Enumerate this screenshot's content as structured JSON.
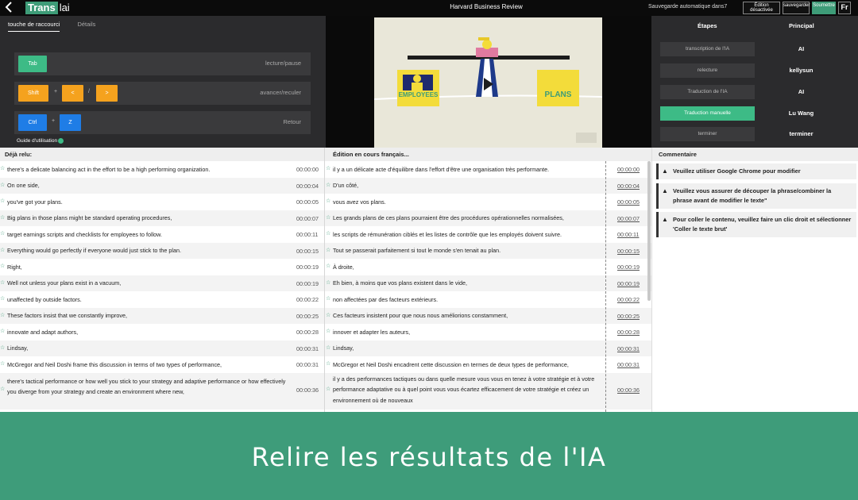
{
  "header": {
    "logo_part1": "Trans",
    "logo_part2": "lai",
    "doc_title": "Harvard Business Review",
    "autosave": "Sauvegarde automatique dans7",
    "edit_disabled": "Édition désactivée",
    "save": "sauvegarder",
    "submit": "Soumettre",
    "lang": "Fr"
  },
  "shortcuts": {
    "tabs": [
      "touche de raccourci",
      "Détails"
    ],
    "rows": [
      {
        "keys": [
          "Tab"
        ],
        "desc": "lecture/pause"
      },
      {
        "keys": [
          "Shift",
          "<",
          ">"
        ],
        "desc": "avancer/reculer"
      },
      {
        "keys": [
          "Ctrl",
          "Z"
        ],
        "desc": "Retour"
      }
    ],
    "sep_plus": "+",
    "sep_slash": "/",
    "guide": "Guide d'utilisation"
  },
  "video": {
    "label_left": "EMPLOYEES",
    "label_right": "PLANS"
  },
  "steps": {
    "col1": "Étapes",
    "col2": "Principal",
    "items": [
      {
        "label": "transcription de l'IA",
        "who": "AI"
      },
      {
        "label": "relecture",
        "who": "kellysun"
      },
      {
        "label": "Traduction de l'IA",
        "who": "AI"
      },
      {
        "label": "Traduction manuelle",
        "who": "Lu Wang"
      },
      {
        "label": "terminer",
        "who": "terminer"
      }
    ]
  },
  "columns": {
    "left": "Déjà relu:",
    "middle": "Édition en cours français...",
    "right": "Commentaire"
  },
  "rows": [
    {
      "en": "there's a delicate balancing act in the effort to be a high performing organization.",
      "t1": "00:00:00",
      "fr": "il y a un délicate acte d'équilibre dans l'effort d'être une organisation très performante.",
      "t2": "00:00:00"
    },
    {
      "en": "On one side,",
      "t1": "00:00:04",
      "fr": "D'un côté,",
      "t2": "00:00:04"
    },
    {
      "en": "you've got your plans.",
      "t1": "00:00:05",
      "fr": "vous avez vos plans.",
      "t2": "00:00:05"
    },
    {
      "en": "Big plans in those plans might be standard operating procedures,",
      "t1": "00:00:07",
      "fr": "Les grands plans de ces plans pourraient être des procédures opérationnelles normalisées,",
      "t2": "00:00:07"
    },
    {
      "en": "target earnings scripts and checklists for employees to follow.",
      "t1": "00:00:11",
      "fr": "les scripts de rémunération ciblés et les listes de contrôle que les employés doivent suivre.",
      "t2": "00:00:11"
    },
    {
      "en": "Everything would go perfectly if everyone would just stick to the plan.",
      "t1": "00:00:15",
      "fr": "Tout se passerait parfaitement si tout le monde s'en tenait au plan.",
      "t2": "00:00:15"
    },
    {
      "en": "Right,",
      "t1": "00:00:19",
      "fr": "À droite,",
      "t2": "00:00:19"
    },
    {
      "en": "Well not unless your plans exist in a vacuum,",
      "t1": "00:00:19",
      "fr": "Eh bien, à moins que vos plans existent dans le vide,",
      "t2": "00:00:19"
    },
    {
      "en": "unaffected by outside factors.",
      "t1": "00:00:22",
      "fr": "non affectées par des facteurs extérieurs.",
      "t2": "00:00:22"
    },
    {
      "en": "These factors insist that we constantly improve,",
      "t1": "00:00:25",
      "fr": "Ces facteurs insistent pour que nous nous améliorions constamment,",
      "t2": "00:00:25"
    },
    {
      "en": "innovate and adapt authors,",
      "t1": "00:00:28",
      "fr": "innover et adapter les auteurs,",
      "t2": "00:00:28"
    },
    {
      "en": "Lindsay,",
      "t1": "00:00:31",
      "fr": "Lindsay,",
      "t2": "00:00:31"
    },
    {
      "en": "McGregor and Neil Doshi frame this discussion in terms of two types of performance,",
      "t1": "00:00:31",
      "fr": "McGregor et Neil Doshi encadrent cette discussion en termes de deux types de performance,",
      "t2": "00:00:31"
    },
    {
      "en": "there's tactical performance or how well you stick to your strategy and adaptive performance or how effectively you diverge from your strategy and create an environment where new,",
      "t1": "00:00:36",
      "fr": "il y a des performances tactiques ou dans quelle mesure vous vous en tenez à votre stratégie et à votre performance adaptative ou à quel point vous vous écartez efficacement de votre stratégie et créez un environnement où de nouveaux",
      "t2": "00:00:36"
    }
  ],
  "comments": [
    "Veuillez utiliser Google Chrome pour modifier",
    "Veuillez vous assurer de découper la phrase/combiner la phrase avant de modifier le texte\"",
    "Pour coller le contenu, veuillez faire un clic droit et sélectionner 'Coller le texte brut'"
  ],
  "banner": "Relire les résultats de l'IA"
}
